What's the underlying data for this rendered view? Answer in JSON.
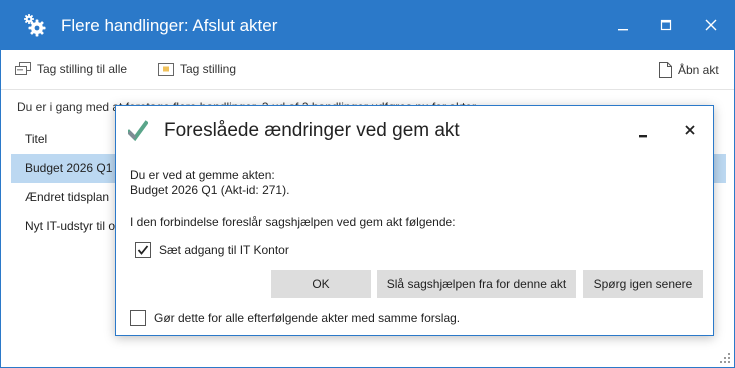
{
  "window": {
    "title": "Flere handlinger: Afslut akter"
  },
  "toolbar": {
    "set_all_label": "Tag stilling til alle",
    "set_label": "Tag stilling",
    "open_label": "Åbn akt"
  },
  "info_line": "Du er i gang med at foretage flere handlinger. 3 ud af 3 handlinger udføres nu for akter",
  "list": {
    "header": "Titel",
    "items": [
      "Budget 2026 Q1",
      "Ændret tidsplan",
      "Nyt IT-udstyr til on"
    ]
  },
  "dialog": {
    "title": "Foreslåede ændringer ved gem akt",
    "line1": "Du er ved at gemme akten:",
    "line2": "Budget 2026 Q1 (Akt-id: 271).",
    "line3": "I den forbindelse foreslår sagshjælpen ved gem akt følgende:",
    "suggestion_label": "Sæt adgang til IT Kontor",
    "suggestion_checked": true,
    "buttons": {
      "ok": "OK",
      "disable": "Slå sagshjælpen fra for denne akt",
      "ask_later": "Spørg igen senere"
    },
    "apply_all_label": "Gør dette for alle efterfølgende akter med samme forslag.",
    "apply_all_checked": false
  },
  "colors": {
    "accent": "#2b79c9",
    "selection": "#bcd8f1",
    "button": "#dddddd"
  }
}
